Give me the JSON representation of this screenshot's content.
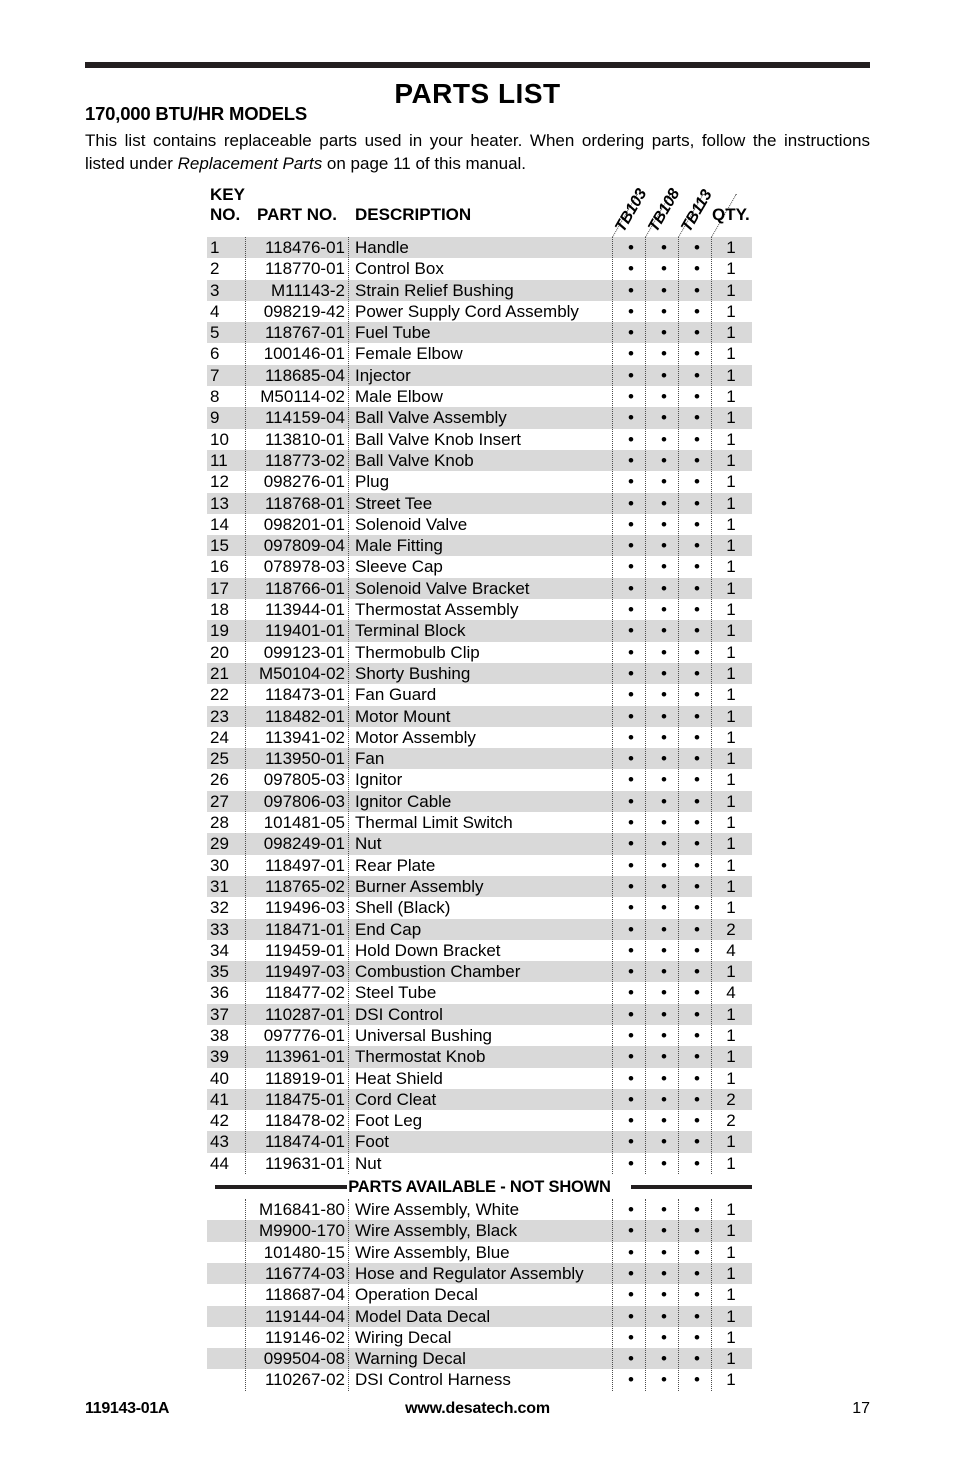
{
  "page": {
    "title": "PARTS LIST",
    "subtitle": "170,000 BTU/HR MODELS",
    "intro_part1": "This list contains replaceable parts used in your heater. When ordering parts, follow the instructions listed under ",
    "intro_italic": "Replacement Parts",
    "intro_part2": " on page 11 of this manual."
  },
  "table": {
    "headers": {
      "key_no": "KEY\nNO.",
      "part_no": "PART NO.",
      "description": "DESCRIPTION",
      "qty": "QTY.",
      "models": [
        "TB103",
        "TB108",
        "TB113"
      ]
    },
    "dot_mark": "•",
    "rows": [
      {
        "key": "1",
        "part": "118476-01",
        "desc": "Handle",
        "m": [
          "•",
          "•",
          "•"
        ],
        "qty": "1"
      },
      {
        "key": "2",
        "part": "118770-01",
        "desc": "Control Box",
        "m": [
          "•",
          "•",
          "•"
        ],
        "qty": "1"
      },
      {
        "key": "3",
        "part": "M11143-2",
        "desc": "Strain Relief Bushing",
        "m": [
          "•",
          "•",
          "•"
        ],
        "qty": "1"
      },
      {
        "key": "4",
        "part": "098219-42",
        "desc": "Power Supply Cord Assembly",
        "m": [
          "•",
          "•",
          "•"
        ],
        "qty": "1"
      },
      {
        "key": "5",
        "part": "118767-01",
        "desc": "Fuel Tube",
        "m": [
          "•",
          "•",
          "•"
        ],
        "qty": "1"
      },
      {
        "key": "6",
        "part": "100146-01",
        "desc": "Female Elbow",
        "m": [
          "•",
          "•",
          "•"
        ],
        "qty": "1"
      },
      {
        "key": "7",
        "part": "118685-04",
        "desc": "Injector",
        "m": [
          "•",
          "•",
          "•"
        ],
        "qty": "1"
      },
      {
        "key": "8",
        "part": "M50114-02",
        "desc": "Male Elbow",
        "m": [
          "•",
          "•",
          "•"
        ],
        "qty": "1"
      },
      {
        "key": "9",
        "part": "114159-04",
        "desc": "Ball Valve Assembly",
        "m": [
          "•",
          "•",
          "•"
        ],
        "qty": "1"
      },
      {
        "key": "10",
        "part": "113810-01",
        "desc": "Ball Valve Knob Insert",
        "m": [
          "•",
          "•",
          "•"
        ],
        "qty": "1"
      },
      {
        "key": "11",
        "part": "118773-02",
        "desc": "Ball Valve Knob",
        "m": [
          "•",
          "•",
          "•"
        ],
        "qty": "1"
      },
      {
        "key": "12",
        "part": "098276-01",
        "desc": "Plug",
        "m": [
          "•",
          "•",
          "•"
        ],
        "qty": "1"
      },
      {
        "key": "13",
        "part": "118768-01",
        "desc": "Street Tee",
        "m": [
          "•",
          "•",
          "•"
        ],
        "qty": "1"
      },
      {
        "key": "14",
        "part": "098201-01",
        "desc": "Solenoid Valve",
        "m": [
          "•",
          "•",
          "•"
        ],
        "qty": "1"
      },
      {
        "key": "15",
        "part": "097809-04",
        "desc": "Male Fitting",
        "m": [
          "•",
          "•",
          "•"
        ],
        "qty": "1"
      },
      {
        "key": "16",
        "part": "078978-03",
        "desc": "Sleeve Cap",
        "m": [
          "•",
          "•",
          "•"
        ],
        "qty": "1"
      },
      {
        "key": "17",
        "part": "118766-01",
        "desc": "Solenoid Valve Bracket",
        "m": [
          "•",
          "•",
          "•"
        ],
        "qty": "1"
      },
      {
        "key": "18",
        "part": "113944-01",
        "desc": "Thermostat Assembly",
        "m": [
          "•",
          "•",
          "•"
        ],
        "qty": "1"
      },
      {
        "key": "19",
        "part": "119401-01",
        "desc": "Terminal Block",
        "m": [
          "•",
          "•",
          "•"
        ],
        "qty": "1"
      },
      {
        "key": "20",
        "part": "099123-01",
        "desc": "Thermobulb Clip",
        "m": [
          "•",
          "•",
          "•"
        ],
        "qty": "1"
      },
      {
        "key": "21",
        "part": "M50104-02",
        "desc": "Shorty Bushing",
        "m": [
          "•",
          "•",
          "•"
        ],
        "qty": "1"
      },
      {
        "key": "22",
        "part": "118473-01",
        "desc": "Fan Guard",
        "m": [
          "•",
          "•",
          "•"
        ],
        "qty": "1"
      },
      {
        "key": "23",
        "part": "118482-01",
        "desc": "Motor Mount",
        "m": [
          "•",
          "•",
          "•"
        ],
        "qty": "1"
      },
      {
        "key": "24",
        "part": "113941-02",
        "desc": "Motor Assembly",
        "m": [
          "•",
          "•",
          "•"
        ],
        "qty": "1"
      },
      {
        "key": "25",
        "part": "113950-01",
        "desc": "Fan",
        "m": [
          "•",
          "•",
          "•"
        ],
        "qty": "1"
      },
      {
        "key": "26",
        "part": "097805-03",
        "desc": "Ignitor",
        "m": [
          "•",
          "•",
          "•"
        ],
        "qty": "1"
      },
      {
        "key": "27",
        "part": "097806-03",
        "desc": "Ignitor Cable",
        "m": [
          "•",
          "•",
          "•"
        ],
        "qty": "1"
      },
      {
        "key": "28",
        "part": "101481-05",
        "desc": "Thermal Limit Switch",
        "m": [
          "•",
          "•",
          "•"
        ],
        "qty": "1"
      },
      {
        "key": "29",
        "part": "098249-01",
        "desc": "Nut",
        "m": [
          "•",
          "•",
          "•"
        ],
        "qty": "1"
      },
      {
        "key": "30",
        "part": "118497-01",
        "desc": "Rear Plate",
        "m": [
          "•",
          "•",
          "•"
        ],
        "qty": "1"
      },
      {
        "key": "31",
        "part": "118765-02",
        "desc": "Burner Assembly",
        "m": [
          "•",
          "•",
          "•"
        ],
        "qty": "1"
      },
      {
        "key": "32",
        "part": "119496-03",
        "desc": "Shell (Black)",
        "m": [
          "•",
          "•",
          "•"
        ],
        "qty": "1"
      },
      {
        "key": "33",
        "part": "118471-01",
        "desc": "End Cap",
        "m": [
          "•",
          "•",
          "•"
        ],
        "qty": "2"
      },
      {
        "key": "34",
        "part": "119459-01",
        "desc": "Hold Down Bracket",
        "m": [
          "•",
          "•",
          "•"
        ],
        "qty": "4"
      },
      {
        "key": "35",
        "part": "119497-03",
        "desc": "Combustion Chamber",
        "m": [
          "•",
          "•",
          "•"
        ],
        "qty": "1"
      },
      {
        "key": "36",
        "part": "118477-02",
        "desc": "Steel Tube",
        "m": [
          "•",
          "•",
          "•"
        ],
        "qty": "4"
      },
      {
        "key": "37",
        "part": "110287-01",
        "desc": "DSI Control",
        "m": [
          "•",
          "•",
          "•"
        ],
        "qty": "1"
      },
      {
        "key": "38",
        "part": "097776-01",
        "desc": "Universal Bushing",
        "m": [
          "•",
          "•",
          "•"
        ],
        "qty": "1"
      },
      {
        "key": "39",
        "part": "113961-01",
        "desc": "Thermostat Knob",
        "m": [
          "•",
          "•",
          "•"
        ],
        "qty": "1"
      },
      {
        "key": "40",
        "part": "118919-01",
        "desc": "Heat Shield",
        "m": [
          "•",
          "•",
          "•"
        ],
        "qty": "1"
      },
      {
        "key": "41",
        "part": "118475-01",
        "desc": "Cord Cleat",
        "m": [
          "•",
          "•",
          "•"
        ],
        "qty": "2"
      },
      {
        "key": "42",
        "part": "118478-02",
        "desc": "Foot Leg",
        "m": [
          "•",
          "•",
          "•"
        ],
        "qty": "2"
      },
      {
        "key": "43",
        "part": "118474-01",
        "desc": "Foot",
        "m": [
          "•",
          "•",
          "•"
        ],
        "qty": "1"
      },
      {
        "key": "44",
        "part": "119631-01",
        "desc": "Nut",
        "m": [
          "•",
          "•",
          "•"
        ],
        "qty": "1"
      }
    ],
    "section_divider_label": "PARTS AVAILABLE - NOT SHOWN",
    "not_shown_rows": [
      {
        "key": "",
        "part": "M16841-80",
        "desc": "Wire Assembly, White",
        "m": [
          "•",
          "•",
          "•"
        ],
        "qty": "1"
      },
      {
        "key": "",
        "part": "M9900-170",
        "desc": "Wire Assembly, Black",
        "m": [
          "•",
          "•",
          "•"
        ],
        "qty": "1"
      },
      {
        "key": "",
        "part": "101480-15",
        "desc": "Wire Assembly, Blue",
        "m": [
          "•",
          "•",
          "•"
        ],
        "qty": "1"
      },
      {
        "key": "",
        "part": "116774-03",
        "desc": "Hose and Regulator Assembly",
        "m": [
          "•",
          "•",
          "•"
        ],
        "qty": "1"
      },
      {
        "key": "",
        "part": "118687-04",
        "desc": "Operation Decal",
        "m": [
          "•",
          "•",
          "•"
        ],
        "qty": "1"
      },
      {
        "key": "",
        "part": "119144-04",
        "desc": "Model Data Decal",
        "m": [
          "•",
          "•",
          "•"
        ],
        "qty": "1"
      },
      {
        "key": "",
        "part": "119146-02",
        "desc": "Wiring Decal",
        "m": [
          "•",
          "•",
          "•"
        ],
        "qty": "1"
      },
      {
        "key": "",
        "part": "099504-08",
        "desc": "Warning Decal",
        "m": [
          "•",
          "•",
          "•"
        ],
        "qty": "1"
      },
      {
        "key": "",
        "part": "110267-02",
        "desc": "DSI Control Harness",
        "m": [
          "•",
          "•",
          "•"
        ],
        "qty": "1"
      }
    ]
  },
  "footer": {
    "doc_number": "119143-01A",
    "website": "www.desatech.com",
    "page_number": "17"
  }
}
